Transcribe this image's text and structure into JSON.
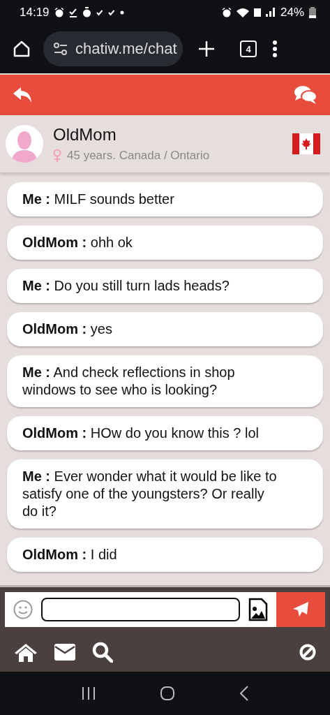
{
  "status_bar": {
    "time": "14:19",
    "battery": "24%"
  },
  "browser": {
    "url": "chatiw.me/chat",
    "tab_count": "4"
  },
  "profile": {
    "name": "OldMom",
    "details": "45 years. Canada / Ontario"
  },
  "messages": [
    {
      "sender": "Me :",
      "text": "MILF sounds better"
    },
    {
      "sender": "OldMom :",
      "text": "ohh ok"
    },
    {
      "sender": "Me :",
      "text": "Do you still turn lads heads?"
    },
    {
      "sender": "OldMom :",
      "text": "yes"
    },
    {
      "sender": "Me :",
      "text": "And check reflections in shop windows to see who is looking?"
    },
    {
      "sender": "OldMom :",
      "text": "HOw do you know this ? lol"
    },
    {
      "sender": "Me :",
      "text": "Ever wonder what it would be like to satisfy one of the youngsters? Or really do it?"
    },
    {
      "sender": "OldMom :",
      "text": "I did"
    }
  ]
}
